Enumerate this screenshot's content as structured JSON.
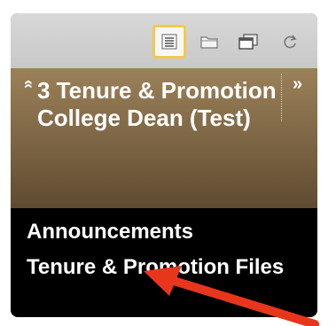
{
  "toolbar": {
    "buttons": [
      {
        "icon": "list-view-icon",
        "active": true
      },
      {
        "icon": "folder-icon",
        "active": false
      },
      {
        "icon": "window-icon",
        "active": false
      },
      {
        "icon": "refresh-icon",
        "active": false
      }
    ]
  },
  "course": {
    "title": "3 Tenure & Promotion College Dean (Test)",
    "collapse_glyph": "»",
    "expand_glyph": "»"
  },
  "menu": {
    "items": [
      {
        "label": "Announcements"
      },
      {
        "label": "Tenure & Promotion Files"
      }
    ]
  },
  "colors": {
    "header_top": "#9b8159",
    "header_bottom": "#5f4b31",
    "menu_bg": "#000000",
    "highlight_border": "#f2c94c",
    "annotation_arrow": "#e8361c"
  }
}
